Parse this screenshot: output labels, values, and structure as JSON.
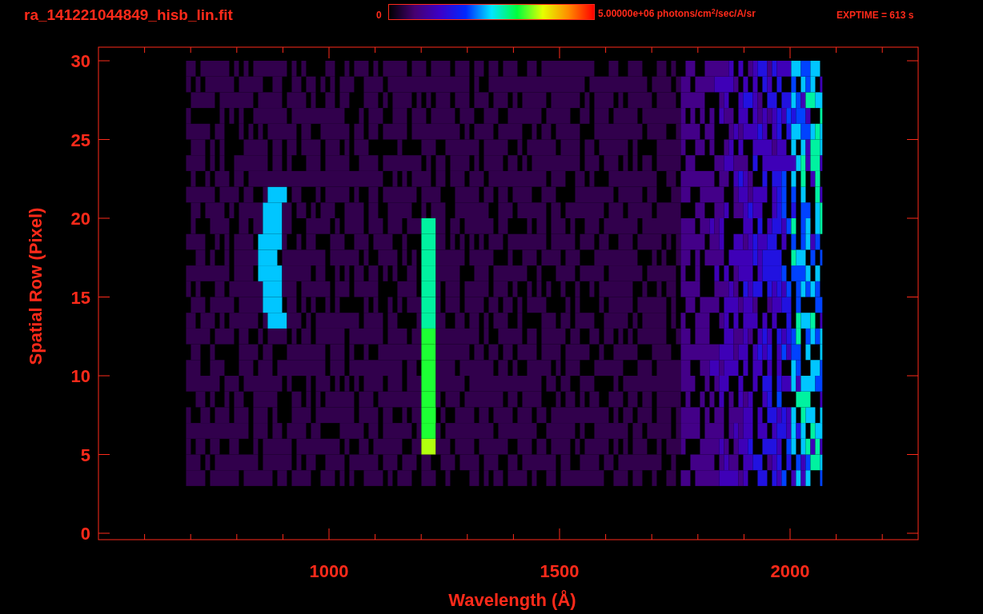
{
  "header": {
    "file_name": "ra_141221044849_hisb_lin.fit",
    "colorbar": {
      "min_label": "0",
      "max_label": "5.00000e+06 photons/cm$^{2}$/sec/A/sr"
    },
    "exposure": "EXPTIME = 613 s"
  },
  "plot": {
    "y_axis": {
      "label": "Spatial Row (Pixel)",
      "ticks": [
        "30",
        "25",
        "20",
        "15",
        "10",
        "5",
        "0"
      ]
    },
    "x_axis": {
      "label": "Wavelength (Å)",
      "ticks": [
        "1000",
        "1500",
        "2000"
      ]
    }
  }
}
